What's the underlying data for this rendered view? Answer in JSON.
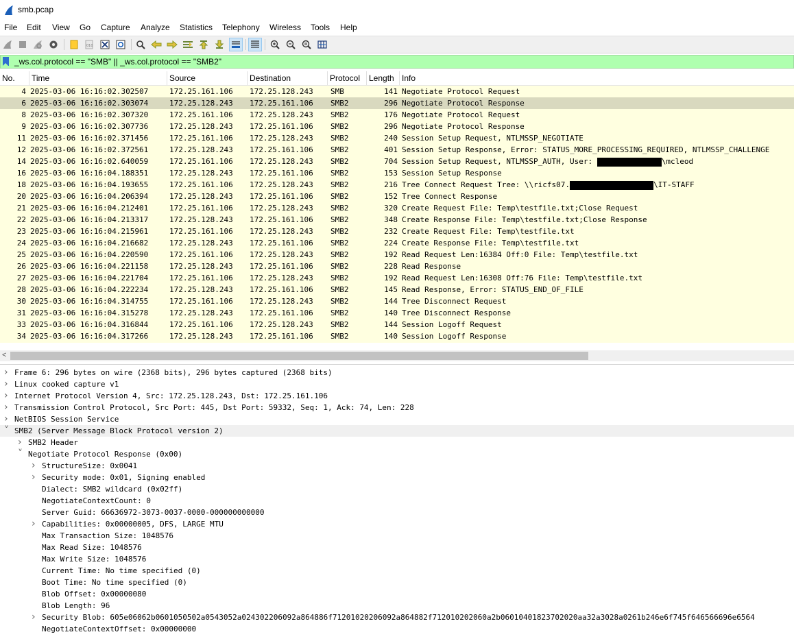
{
  "window": {
    "title": "smb.pcap"
  },
  "menu": [
    "File",
    "Edit",
    "View",
    "Go",
    "Capture",
    "Analyze",
    "Statistics",
    "Telephony",
    "Wireless",
    "Tools",
    "Help"
  ],
  "colors": {
    "filter_bg": "#afffaf",
    "packet_list_bg": "#ffffe0",
    "selected_row": "#d9d9bf"
  },
  "filter": {
    "text": "_ws.col.protocol == \"SMB\" || _ws.col.protocol == \"SMB2\""
  },
  "columns": {
    "no": "No.",
    "time": "Time",
    "source": "Source",
    "destination": "Destination",
    "protocol": "Protocol",
    "length": "Length",
    "info": "Info"
  },
  "packets": [
    {
      "no": "4",
      "time": "2025-03-06 16:16:02.302507",
      "src": "172.25.161.106",
      "dst": "172.25.128.243",
      "proto": "SMB",
      "len": "141",
      "info": "Negotiate Protocol Request"
    },
    {
      "no": "6",
      "time": "2025-03-06 16:16:02.303074",
      "src": "172.25.128.243",
      "dst": "172.25.161.106",
      "proto": "SMB2",
      "len": "296",
      "info": "Negotiate Protocol Response"
    },
    {
      "no": "8",
      "time": "2025-03-06 16:16:02.307320",
      "src": "172.25.161.106",
      "dst": "172.25.128.243",
      "proto": "SMB2",
      "len": "176",
      "info": "Negotiate Protocol Request"
    },
    {
      "no": "9",
      "time": "2025-03-06 16:16:02.307736",
      "src": "172.25.128.243",
      "dst": "172.25.161.106",
      "proto": "SMB2",
      "len": "296",
      "info": "Negotiate Protocol Response"
    },
    {
      "no": "11",
      "time": "2025-03-06 16:16:02.371456",
      "src": "172.25.161.106",
      "dst": "172.25.128.243",
      "proto": "SMB2",
      "len": "240",
      "info": "Session Setup Request, NTLMSSP_NEGOTIATE"
    },
    {
      "no": "12",
      "time": "2025-03-06 16:16:02.372561",
      "src": "172.25.128.243",
      "dst": "172.25.161.106",
      "proto": "SMB2",
      "len": "401",
      "info": "Session Setup Response, Error: STATUS_MORE_PROCESSING_REQUIRED, NTLMSSP_CHALLENGE"
    },
    {
      "no": "14",
      "time": "2025-03-06 16:16:02.640059",
      "src": "172.25.161.106",
      "dst": "172.25.128.243",
      "proto": "SMB2",
      "len": "704",
      "info_pre": "Session Setup Request, NTLMSSP_AUTH, User: ",
      "info_post": "\\mcleod"
    },
    {
      "no": "16",
      "time": "2025-03-06 16:16:04.188351",
      "src": "172.25.128.243",
      "dst": "172.25.161.106",
      "proto": "SMB2",
      "len": "153",
      "info": "Session Setup Response"
    },
    {
      "no": "18",
      "time": "2025-03-06 16:16:04.193655",
      "src": "172.25.161.106",
      "dst": "172.25.128.243",
      "proto": "SMB2",
      "len": "216",
      "info_pre": "Tree Connect Request Tree: \\\\ricfs07.",
      "info_post": "\\IT-STAFF"
    },
    {
      "no": "20",
      "time": "2025-03-06 16:16:04.206394",
      "src": "172.25.128.243",
      "dst": "172.25.161.106",
      "proto": "SMB2",
      "len": "152",
      "info": "Tree Connect Response"
    },
    {
      "no": "21",
      "time": "2025-03-06 16:16:04.212401",
      "src": "172.25.161.106",
      "dst": "172.25.128.243",
      "proto": "SMB2",
      "len": "320",
      "info": "Create Request File: Temp\\testfile.txt;Close Request"
    },
    {
      "no": "22",
      "time": "2025-03-06 16:16:04.213317",
      "src": "172.25.128.243",
      "dst": "172.25.161.106",
      "proto": "SMB2",
      "len": "348",
      "info": "Create Response File: Temp\\testfile.txt;Close Response"
    },
    {
      "no": "23",
      "time": "2025-03-06 16:16:04.215961",
      "src": "172.25.161.106",
      "dst": "172.25.128.243",
      "proto": "SMB2",
      "len": "232",
      "info": "Create Request File: Temp\\testfile.txt"
    },
    {
      "no": "24",
      "time": "2025-03-06 16:16:04.216682",
      "src": "172.25.128.243",
      "dst": "172.25.161.106",
      "proto": "SMB2",
      "len": "224",
      "info": "Create Response File: Temp\\testfile.txt"
    },
    {
      "no": "25",
      "time": "2025-03-06 16:16:04.220590",
      "src": "172.25.161.106",
      "dst": "172.25.128.243",
      "proto": "SMB2",
      "len": "192",
      "info": "Read Request Len:16384 Off:0 File: Temp\\testfile.txt"
    },
    {
      "no": "26",
      "time": "2025-03-06 16:16:04.221158",
      "src": "172.25.128.243",
      "dst": "172.25.161.106",
      "proto": "SMB2",
      "len": "228",
      "info": "Read Response"
    },
    {
      "no": "27",
      "time": "2025-03-06 16:16:04.221704",
      "src": "172.25.161.106",
      "dst": "172.25.128.243",
      "proto": "SMB2",
      "len": "192",
      "info": "Read Request Len:16308 Off:76 File: Temp\\testfile.txt"
    },
    {
      "no": "28",
      "time": "2025-03-06 16:16:04.222234",
      "src": "172.25.128.243",
      "dst": "172.25.161.106",
      "proto": "SMB2",
      "len": "145",
      "info": "Read Response, Error: STATUS_END_OF_FILE"
    },
    {
      "no": "30",
      "time": "2025-03-06 16:16:04.314755",
      "src": "172.25.161.106",
      "dst": "172.25.128.243",
      "proto": "SMB2",
      "len": "144",
      "info": "Tree Disconnect Request"
    },
    {
      "no": "31",
      "time": "2025-03-06 16:16:04.315278",
      "src": "172.25.128.243",
      "dst": "172.25.161.106",
      "proto": "SMB2",
      "len": "140",
      "info": "Tree Disconnect Response"
    },
    {
      "no": "33",
      "time": "2025-03-06 16:16:04.316844",
      "src": "172.25.161.106",
      "dst": "172.25.128.243",
      "proto": "SMB2",
      "len": "144",
      "info": "Session Logoff Request"
    },
    {
      "no": "34",
      "time": "2025-03-06 16:16:04.317266",
      "src": "172.25.128.243",
      "dst": "172.25.161.106",
      "proto": "SMB2",
      "len": "140",
      "info": "Session Logoff Response"
    }
  ],
  "selected_packet": "6",
  "details": [
    {
      "level": 0,
      "state": "collapsed",
      "text": "Frame 6: 296 bytes on wire (2368 bits), 296 bytes captured (2368 bits)"
    },
    {
      "level": 0,
      "state": "collapsed",
      "text": "Linux cooked capture v1"
    },
    {
      "level": 0,
      "state": "collapsed",
      "text": "Internet Protocol Version 4, Src: 172.25.128.243, Dst: 172.25.161.106"
    },
    {
      "level": 0,
      "state": "collapsed",
      "text": "Transmission Control Protocol, Src Port: 445, Dst Port: 59332, Seq: 1, Ack: 74, Len: 228"
    },
    {
      "level": 0,
      "state": "collapsed",
      "text": "NetBIOS Session Service"
    },
    {
      "level": 0,
      "state": "expanded",
      "text": "SMB2 (Server Message Block Protocol version 2)",
      "highlight": true
    },
    {
      "level": 1,
      "state": "collapsed",
      "text": "SMB2 Header"
    },
    {
      "level": 1,
      "state": "expanded",
      "text": "Negotiate Protocol Response (0x00)"
    },
    {
      "level": 2,
      "state": "collapsed",
      "text": "StructureSize: 0x0041"
    },
    {
      "level": 2,
      "state": "collapsed",
      "text": "Security mode: 0x01, Signing enabled"
    },
    {
      "level": 2,
      "state": "leaf",
      "text": "Dialect: SMB2 wildcard (0x02ff)"
    },
    {
      "level": 2,
      "state": "leaf",
      "text": "NegotiateContextCount: 0"
    },
    {
      "level": 2,
      "state": "leaf",
      "text": "Server Guid: 66636972-3073-0037-0000-000000000000"
    },
    {
      "level": 2,
      "state": "collapsed",
      "text": "Capabilities: 0x00000005, DFS, LARGE MTU"
    },
    {
      "level": 2,
      "state": "leaf",
      "text": "Max Transaction Size: 1048576"
    },
    {
      "level": 2,
      "state": "leaf",
      "text": "Max Read Size: 1048576"
    },
    {
      "level": 2,
      "state": "leaf",
      "text": "Max Write Size: 1048576"
    },
    {
      "level": 2,
      "state": "leaf",
      "text": "Current Time: No time specified (0)"
    },
    {
      "level": 2,
      "state": "leaf",
      "text": "Boot Time: No time specified (0)"
    },
    {
      "level": 2,
      "state": "leaf",
      "text": "Blob Offset: 0x00000080"
    },
    {
      "level": 2,
      "state": "leaf",
      "text": "Blob Length: 96"
    },
    {
      "level": 2,
      "state": "collapsed",
      "text": "Security Blob: 605e06062b0601050502a0543052a024302206092a864886f71201020206092a864882f712010202060a2b06010401823702020aa32a3028a0261b246e6f745f646566696e6564"
    },
    {
      "level": 2,
      "state": "leaf",
      "text": "NegotiateContextOffset: 0x00000000"
    }
  ],
  "toolbar_icons": [
    "shark-fin-start-icon",
    "stop-icon",
    "restart-icon",
    "capture-options-icon",
    "open-file-icon",
    "save-file-icon",
    "close-file-icon",
    "reload-icon",
    "find-packet-icon",
    "go-back-icon",
    "go-forward-icon",
    "go-to-packet-icon",
    "go-first-icon",
    "go-last-icon",
    "autoscroll-icon",
    "colorize-icon",
    "zoom-in-icon",
    "zoom-out-icon",
    "zoom-normal-icon",
    "resize-columns-icon"
  ]
}
